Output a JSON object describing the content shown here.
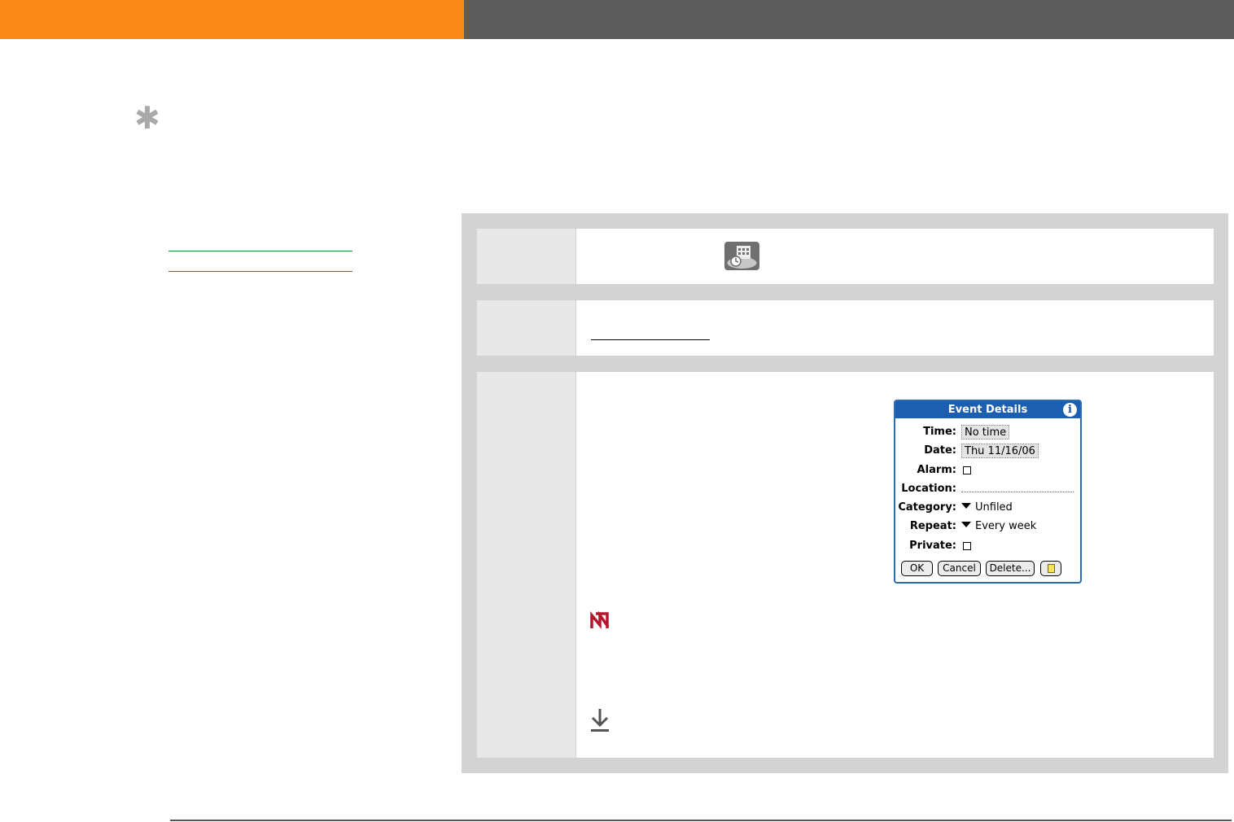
{
  "colors": {
    "header_orange": "#f98a17",
    "header_gray": "#5d5d5d",
    "link_green": "#2a8a2a",
    "dialog_blue": "#1c5fb0",
    "tip_red": "#b5162d",
    "rule_gray": "#555555"
  },
  "icons": {
    "tip": "asterisk-icon",
    "calendar_app": "calendar-app-icon",
    "note": "palm-warning-icon",
    "more": "download-arrow-icon"
  },
  "dialog": {
    "title": "Event Details",
    "info_glyph": "i",
    "labels": {
      "time": "Time:",
      "date": "Date:",
      "alarm": "Alarm:",
      "location": "Location:",
      "category": "Category:",
      "repeat": "Repeat:",
      "private": "Private:"
    },
    "values": {
      "time": "No time",
      "date": "Thu 11/16/06",
      "alarm_checked": false,
      "location": "",
      "category": "Unfiled",
      "repeat": "Every week",
      "private_checked": false
    },
    "buttons": {
      "ok": "OK",
      "cancel": "Cancel",
      "delete": "Delete..."
    }
  }
}
